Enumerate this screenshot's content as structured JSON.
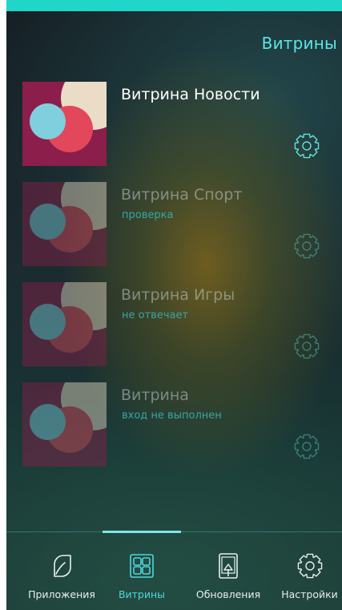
{
  "header": {
    "title": "Витрины"
  },
  "showcases": [
    {
      "title": "Витрина Новости",
      "status": "",
      "active": true
    },
    {
      "title": "Витрина Спорт",
      "status": "проверка",
      "active": false
    },
    {
      "title": "Витрина Игры",
      "status": "не отвечает",
      "active": false
    },
    {
      "title": "Витрина",
      "status": "вход не выполнен",
      "active": false
    }
  ],
  "bottom_nav": {
    "apps": "Приложения",
    "showcases": "Витрины",
    "updates": "Обновления",
    "settings": "Настройки",
    "active_tab": "showcases"
  },
  "colors": {
    "accent": "#1fd6c8",
    "title_text": "#5fe4e6",
    "status_text": "#38a5a6",
    "thumb_background": "#8c1e4b",
    "thumb_cream": "#ebdcc7",
    "thumb_red": "#e2475b",
    "thumb_blue": "#7fcfdf"
  },
  "icons": {
    "item_settings": "gear-icon",
    "apps": "leaf-icon",
    "showcases": "grid-icon",
    "updates": "device-upload-icon",
    "settings": "gear-icon"
  }
}
